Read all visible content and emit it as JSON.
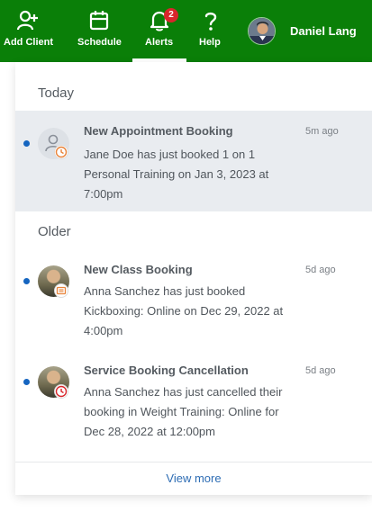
{
  "nav": {
    "items": [
      {
        "label": "Add Client",
        "icon": "add-user-icon"
      },
      {
        "label": "Schedule",
        "icon": "calendar-icon"
      },
      {
        "label": "Alerts",
        "icon": "bell-icon",
        "badge": "2",
        "active": true
      },
      {
        "label": "Help",
        "icon": "question-icon"
      }
    ],
    "user": {
      "name": "Daniel Lang"
    }
  },
  "panel": {
    "sections": {
      "today": "Today",
      "older": "Older"
    },
    "notifications": [
      {
        "title": "New Appointment Booking",
        "body": "Jane Doe has just booked 1 on 1 Personal Training on Jan 3, 2023 at 7:00pm",
        "time": "5m ago",
        "avatar": "generic-user",
        "badge_icon": "clock-icon",
        "badge_color": "#e8833a",
        "unread": true
      },
      {
        "title": "New Class Booking",
        "body": "Anna Sanchez has just booked Kickboxing: Online on Dec 29, 2022 at 4:00pm",
        "time": "5d ago",
        "avatar": "photo",
        "badge_icon": "class-icon",
        "badge_color": "#e8833a",
        "unread": true
      },
      {
        "title": "Service Booking Cancellation",
        "body": "Anna Sanchez has just cancelled their booking in Weight Training: Online for Dec 28, 2022 at 12:00pm",
        "time": "5d ago",
        "avatar": "photo",
        "badge_icon": "cancel-clock-icon",
        "badge_color": "#d8262b",
        "unread": true
      }
    ],
    "view_more": "View more"
  },
  "colors": {
    "nav_bg": "#0a7f08",
    "badge_red": "#d8262b",
    "unread_dot": "#1565c0",
    "link": "#2e6db4",
    "highlight_bg": "#e9ecf0"
  }
}
